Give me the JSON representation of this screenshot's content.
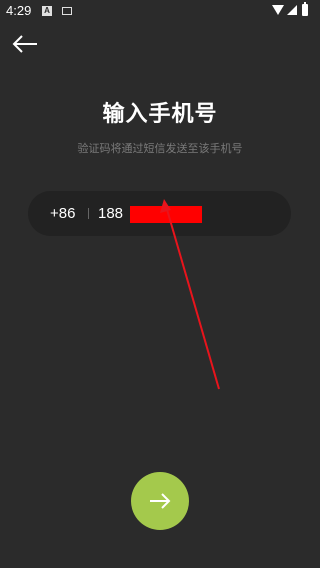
{
  "status_bar": {
    "time": "4:29",
    "notification_glyph": "A"
  },
  "header": {
    "back_icon": "arrow-left-icon"
  },
  "main": {
    "title": "输入手机号",
    "subtitle": "验证码将通过短信发送至该手机号"
  },
  "phone_input": {
    "country_code": "+86",
    "value_visible": "188"
  },
  "footer": {
    "next_icon": "arrow-right-icon"
  },
  "colors": {
    "background": "#2b2b2b",
    "field_background": "#222222",
    "accent": "#a4c94c",
    "annotation": "#e8141c"
  }
}
